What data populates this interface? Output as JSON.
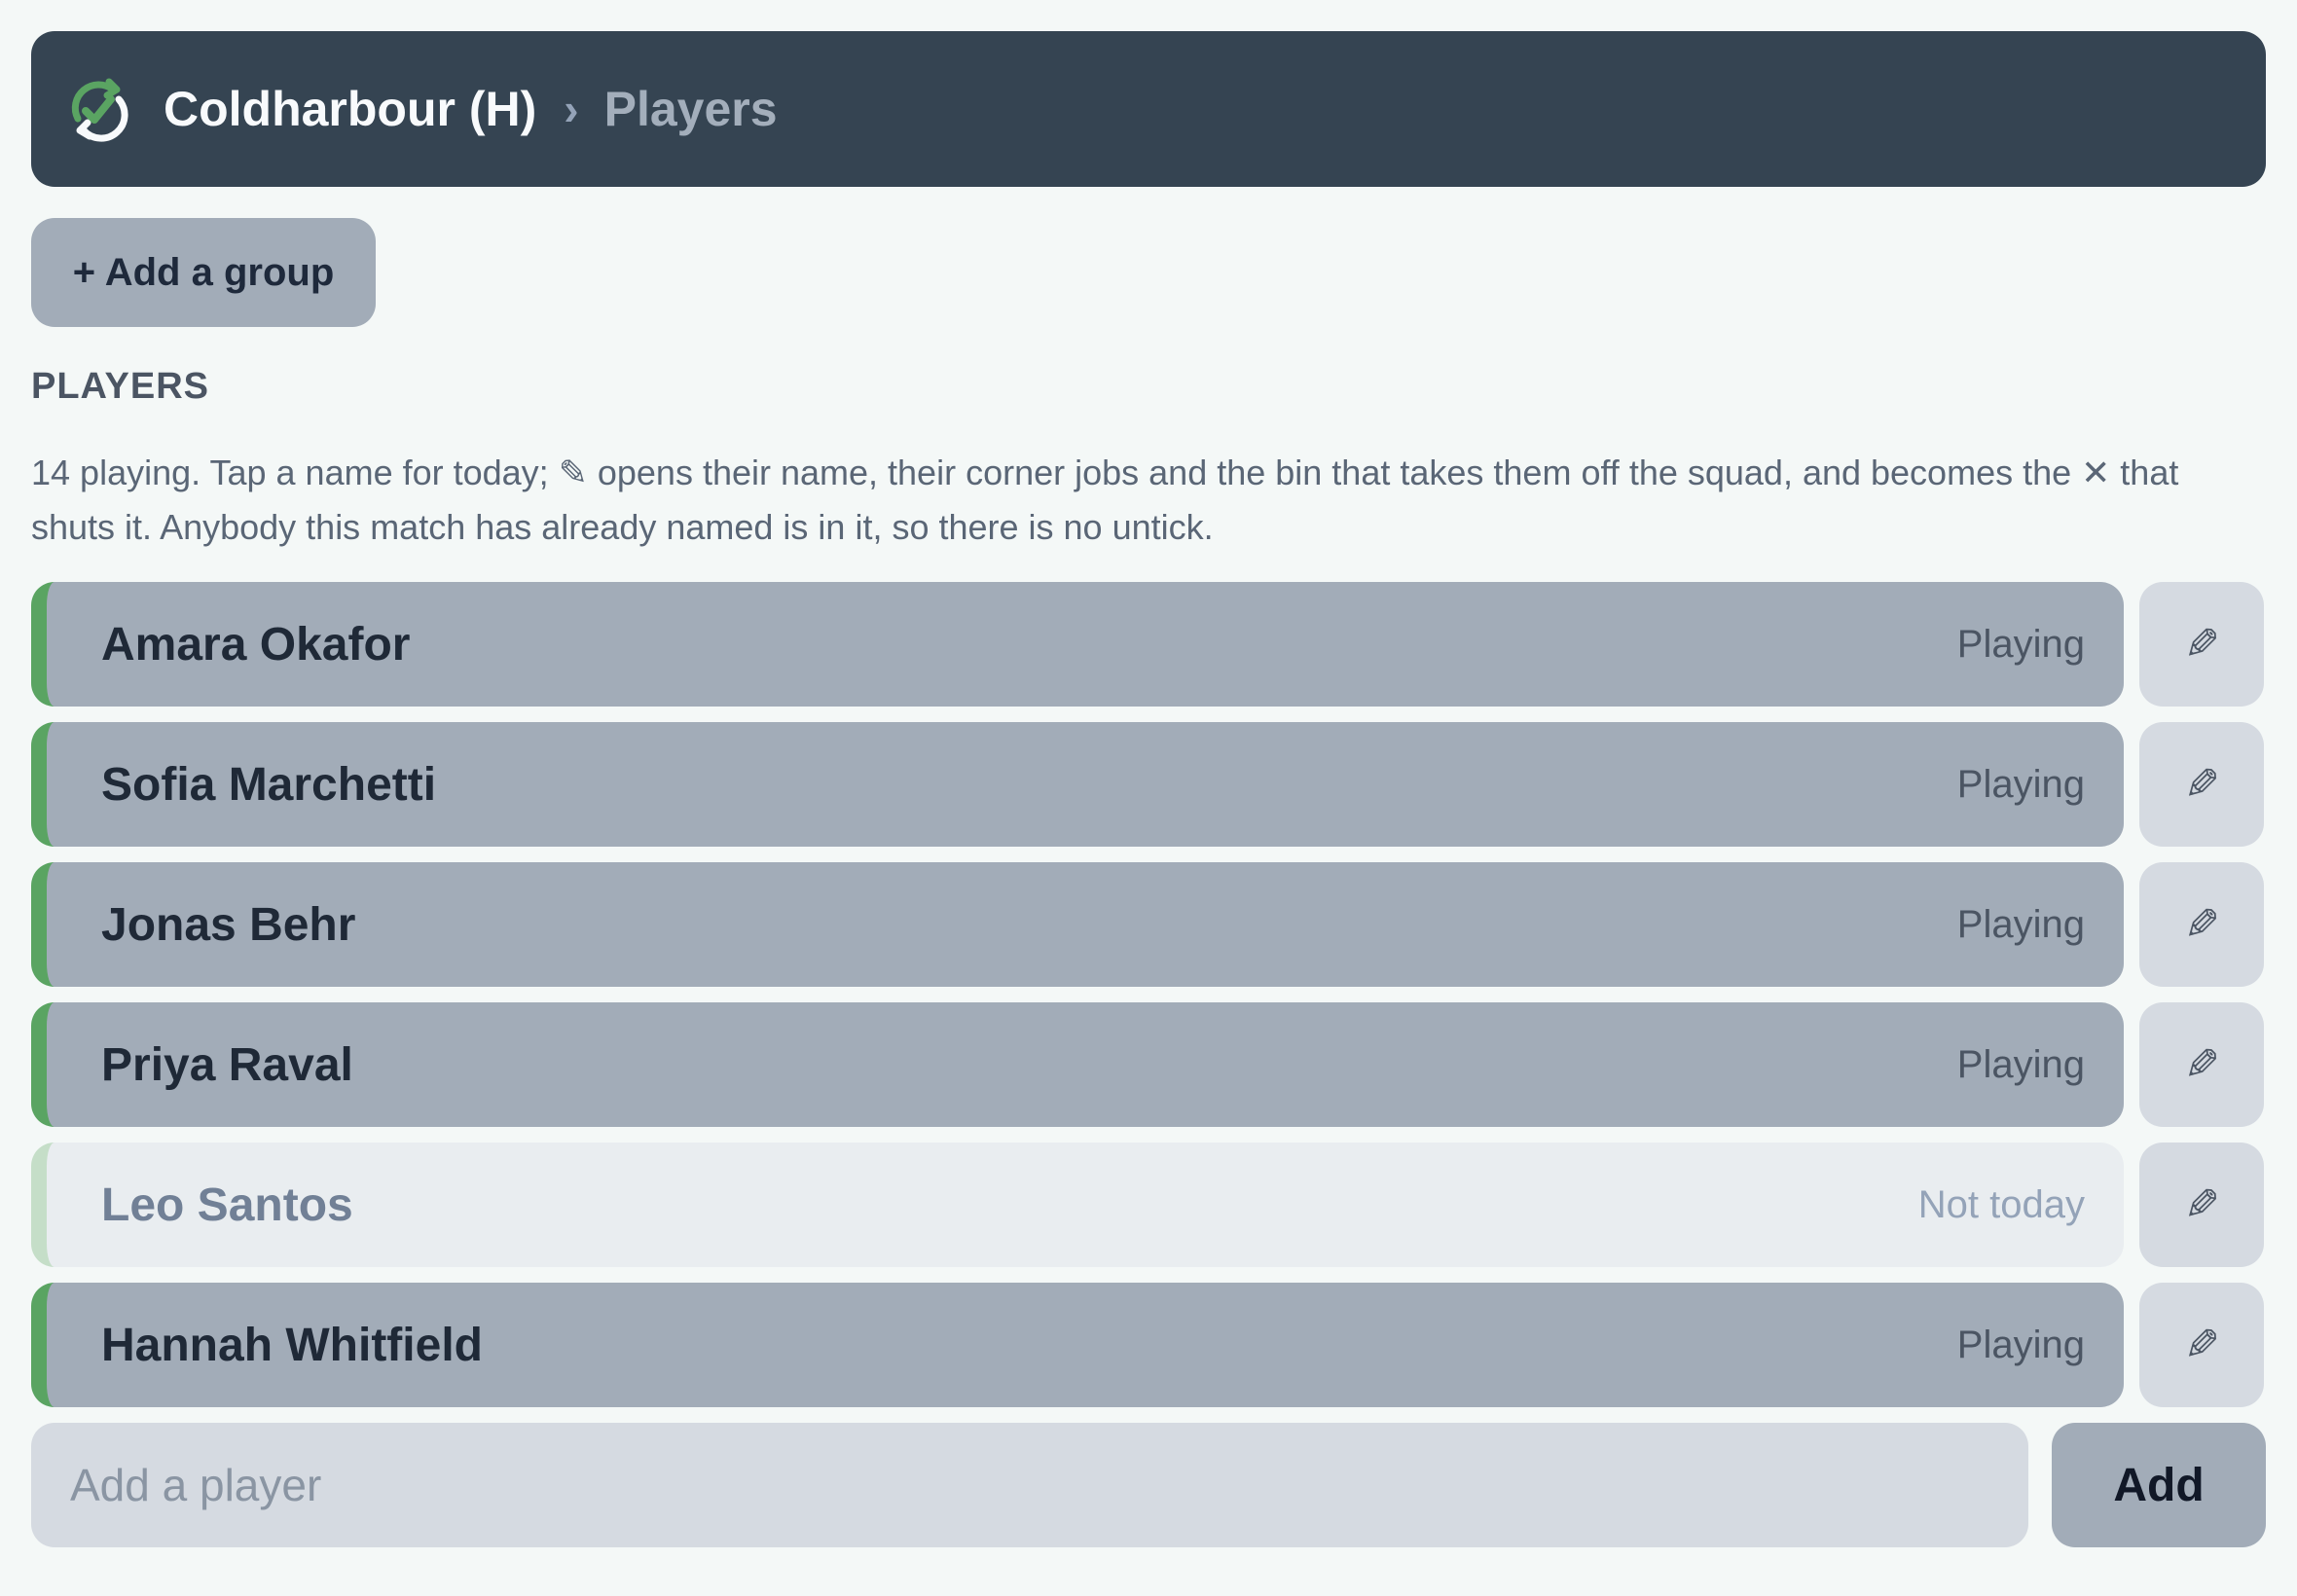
{
  "header": {
    "logo_icon": "refresh-check-icon",
    "breadcrumb_root": "Coldharbour (H)",
    "breadcrumb_separator": "›",
    "breadcrumb_current": "Players",
    "colors": {
      "background": "#354452",
      "logo_green": "#5aa462"
    }
  },
  "toolbar": {
    "add_group_label": "+ Add a group"
  },
  "players_section": {
    "title": "PLAYERS",
    "hint": "14 playing. Tap a name for today; ✎ opens their name, their corner jobs and the bin that takes them off the squad, and becomes the ✕ that shuts it. Anybody this match has already named is in it, so there is no untick.",
    "edit_icon": "pencil-icon",
    "players": [
      {
        "name": "Amara Okafor",
        "status": "Playing",
        "playing": true
      },
      {
        "name": "Sofia Marchetti",
        "status": "Playing",
        "playing": true
      },
      {
        "name": "Jonas Behr",
        "status": "Playing",
        "playing": true
      },
      {
        "name": "Priya Raval",
        "status": "Playing",
        "playing": true
      },
      {
        "name": "Leo Santos",
        "status": "Not today",
        "playing": false
      },
      {
        "name": "Hannah Whitfield",
        "status": "Playing",
        "playing": true
      }
    ],
    "colors": {
      "playing_accent": "#5aa462",
      "not_today_accent": "#c5dec8"
    }
  },
  "add_player": {
    "placeholder": "Add a player",
    "value": "",
    "button_label": "Add"
  }
}
